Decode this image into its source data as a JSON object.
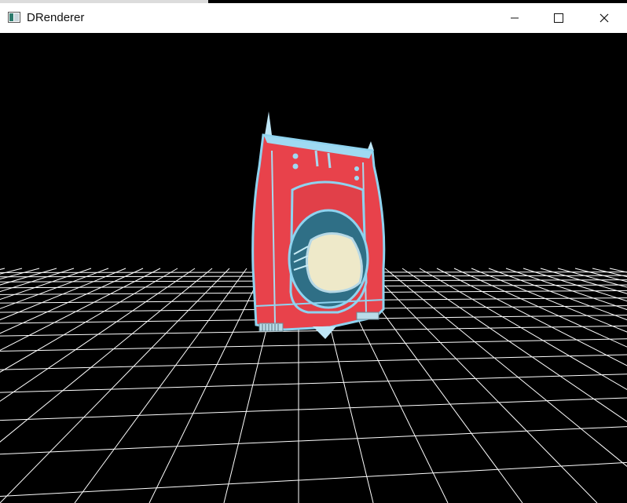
{
  "window": {
    "title": "DRenderer",
    "icon": "app-window-icon",
    "controls": {
      "minimize_icon": "minimize-icon",
      "maximize_icon": "maximize-icon",
      "close_icon": "close-icon"
    }
  },
  "scene": {
    "background_color": "#000000",
    "grid_color": "#ffffff",
    "model_primary_color": "#e8424b",
    "model_trim_color": "#8fd3ef",
    "model_window_color": "#2f6f86",
    "model_dome_color": "#eee9c9"
  }
}
